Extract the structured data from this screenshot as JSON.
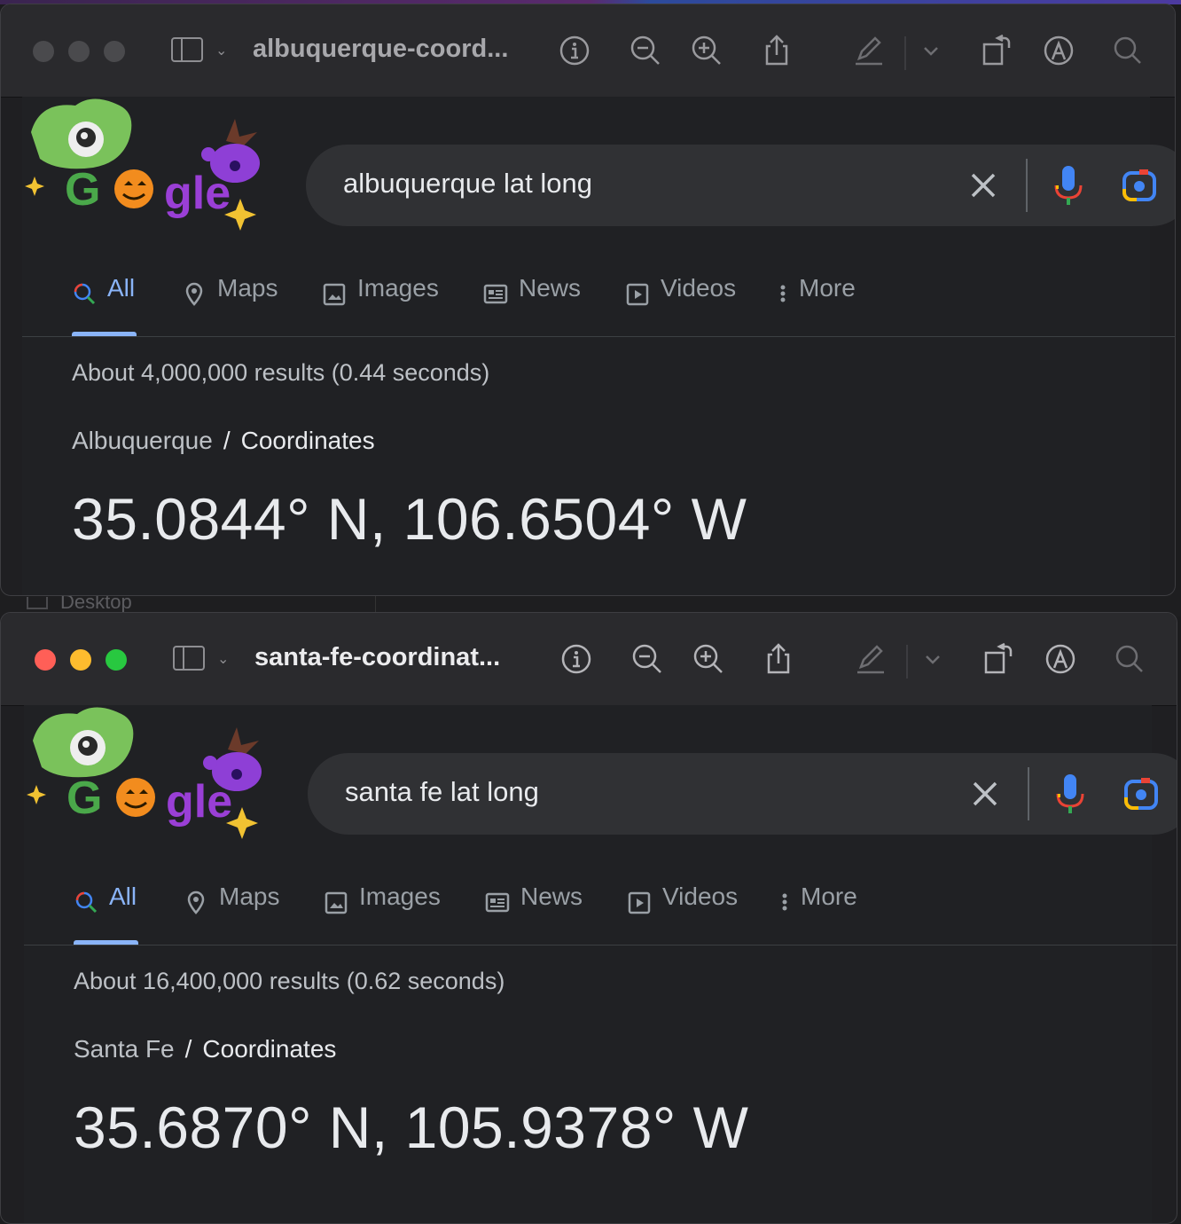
{
  "colors": {
    "accent": "#8ab4f8",
    "background": "#202124",
    "searchbox": "#303134",
    "text": "#e8eaed",
    "muted": "#bdc1c6"
  },
  "windows": [
    {
      "title": "albuquerque-coord...",
      "search_query": "albuquerque lat long",
      "tabs": [
        {
          "label": "All",
          "icon": "search-icon",
          "active": true
        },
        {
          "label": "Maps",
          "icon": "map-pin-icon"
        },
        {
          "label": "Images",
          "icon": "image-icon"
        },
        {
          "label": "News",
          "icon": "news-icon"
        },
        {
          "label": "Videos",
          "icon": "video-icon"
        },
        {
          "label": "More",
          "icon": "more-vert-icon"
        }
      ],
      "stats": "About 4,000,000 results (0.44 seconds)",
      "breadcrumb": {
        "place": "Albuquerque",
        "separator": "/",
        "topic": "Coordinates"
      },
      "answer": "35.0844° N, 106.6504° W"
    },
    {
      "title": "santa-fe-coordinat...",
      "search_query": "santa fe lat long",
      "tabs": [
        {
          "label": "All",
          "icon": "search-icon",
          "active": true
        },
        {
          "label": "Maps",
          "icon": "map-pin-icon"
        },
        {
          "label": "Images",
          "icon": "image-icon"
        },
        {
          "label": "News",
          "icon": "news-icon"
        },
        {
          "label": "Videos",
          "icon": "video-icon"
        },
        {
          "label": "More",
          "icon": "more-vert-icon"
        }
      ],
      "stats": "About 16,400,000 results (0.62 seconds)",
      "breadcrumb": {
        "place": "Santa Fe",
        "separator": "/",
        "topic": "Coordinates"
      },
      "answer": "35.6870° N, 105.9378° W"
    }
  ],
  "background": {
    "desktop_label": "Desktop"
  }
}
